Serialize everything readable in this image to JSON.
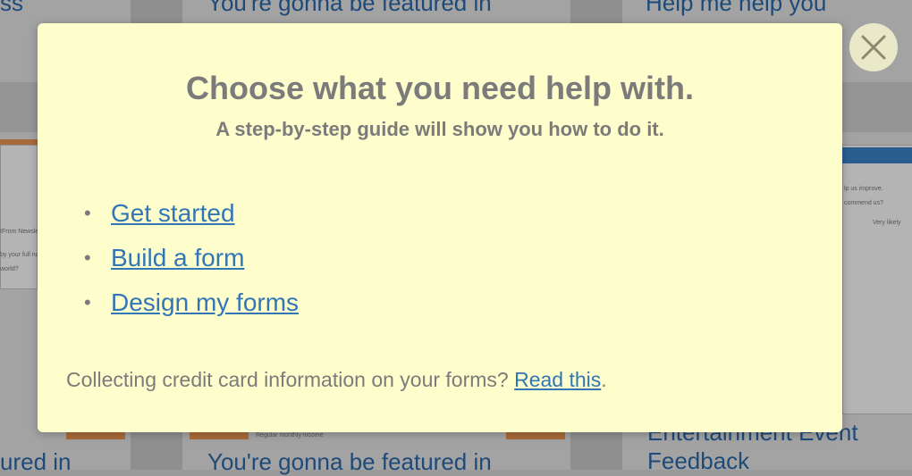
{
  "background": {
    "card_titles_top": [
      "ss",
      "You're gonna be featured in",
      "Help me help you"
    ],
    "card_titles_bottom": [
      "ured in",
      "You're gonna be featured in",
      "Entertainment Event Feedback"
    ],
    "thumb_snippets": [
      "Regular monthly income",
      "lp us improve.",
      "commend us?",
      "Very likely",
      "tFrom Newslet",
      "by your full na",
      "world?"
    ]
  },
  "modal": {
    "title": "Choose what you need help with.",
    "subtitle": "A step-by-step guide will show you how to do it.",
    "bullet_glyph": "•",
    "links": [
      "Get started",
      "Build a form",
      "Design my forms"
    ],
    "footer_text": "Collecting credit card information on your forms?",
    "footer_link": "Read this",
    "footer_end": "."
  },
  "close_button": {
    "icon": "close-icon"
  },
  "colors": {
    "modal_bg": "#fefecd",
    "link": "#3176b6",
    "text": "#7b7b7b",
    "overlay": "#9a9a9a"
  }
}
